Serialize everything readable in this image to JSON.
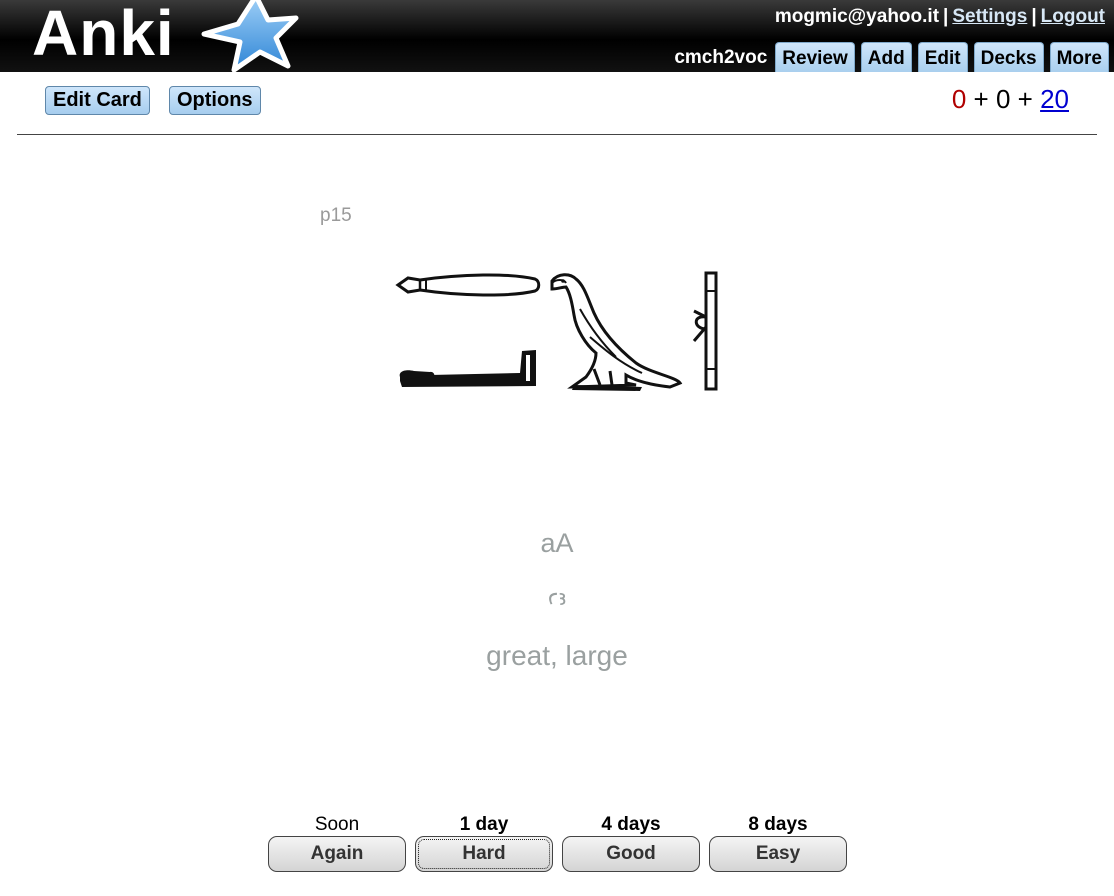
{
  "header": {
    "logo_text": "Anki",
    "user": "mogmic@yahoo.it",
    "settings": "Settings",
    "logout": "Logout",
    "separator": "|",
    "deck": "cmch2voc",
    "tabs": [
      "Review",
      "Add",
      "Edit",
      "Decks",
      "More"
    ]
  },
  "toolbar": {
    "edit_card": "Edit Card",
    "options": "Options",
    "counts": {
      "failed": "0",
      "review": "0",
      "new": "20",
      "plus": "+"
    }
  },
  "card": {
    "page_ref": "p15",
    "transliteration": "aA",
    "glyph": "ꜥꜣ",
    "meaning": "great, large",
    "hieroglyph_icon": "hieroglyph-image"
  },
  "answers": [
    {
      "due": "Soon",
      "label": "Again",
      "bold_due": false
    },
    {
      "due": "1 day",
      "label": "Hard",
      "bold_due": true
    },
    {
      "due": "4 days",
      "label": "Good",
      "bold_due": true
    },
    {
      "due": "8 days",
      "label": "Easy",
      "bold_due": true
    }
  ],
  "colors": {
    "accent_tab": "#a9cfee",
    "failed_count": "#b00000",
    "new_count": "#0000d0"
  }
}
